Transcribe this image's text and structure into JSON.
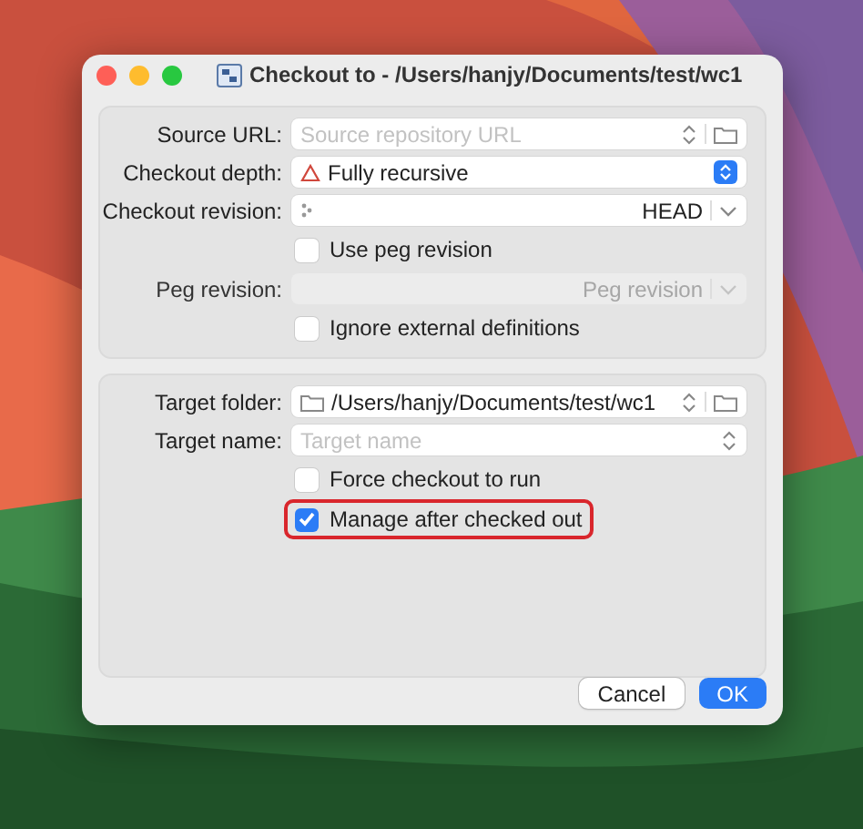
{
  "window": {
    "title": "Checkout to - /Users/hanjy/Documents/test/wc1"
  },
  "sections": [
    {
      "rows": [
        {
          "kind": "combo",
          "label": "Source URL:",
          "placeholder": "Source repository URL",
          "browse": true,
          "disabled": false
        },
        {
          "kind": "popup",
          "label": "Checkout depth:",
          "value": "Fully recursive"
        },
        {
          "kind": "revision",
          "label": "Checkout revision:",
          "value": "HEAD",
          "disabled": false
        },
        {
          "kind": "checkbox",
          "label": "Use peg revision",
          "checked": false,
          "highlighted": false
        },
        {
          "kind": "revision",
          "label": "Peg revision:",
          "placeholder": "Peg revision",
          "disabled": true
        },
        {
          "kind": "checkbox",
          "label": "Ignore external definitions",
          "checked": false,
          "highlighted": false
        }
      ]
    },
    {
      "rows": [
        {
          "kind": "folder",
          "label": "Target folder:",
          "value": "/Users/hanjy/Documents/test/wc1",
          "browse": true,
          "disabled": false
        },
        {
          "kind": "combo",
          "label": "Target name:",
          "placeholder": "Target name",
          "browse": false,
          "disabled": false
        },
        {
          "kind": "checkbox",
          "label": "Force checkout to run",
          "checked": false,
          "highlighted": false
        },
        {
          "kind": "checkbox",
          "label": "Manage after checked out",
          "checked": true,
          "highlighted": true
        }
      ]
    }
  ],
  "buttons": [
    {
      "label": "Cancel",
      "default": false
    },
    {
      "label": "OK",
      "default": true
    }
  ]
}
